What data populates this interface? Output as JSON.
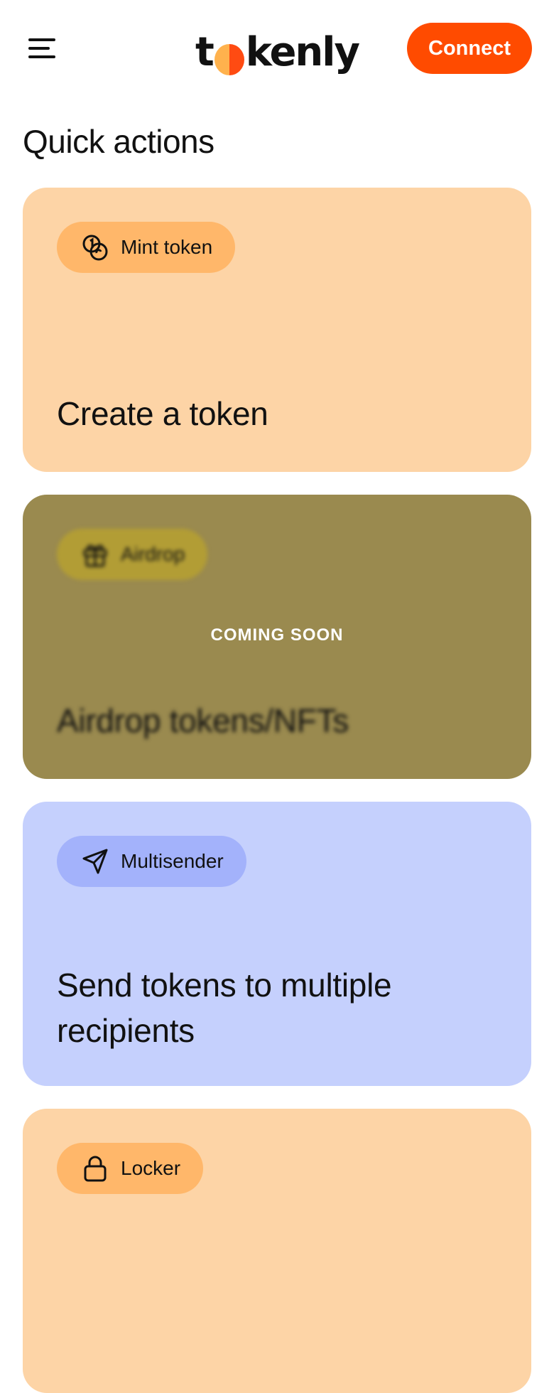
{
  "header": {
    "logo_text_left": "t",
    "logo_text_right": "kenly",
    "connect_label": "Connect",
    "brand_color": "#ff4b00"
  },
  "page": {
    "section_title": "Quick actions"
  },
  "cards": [
    {
      "pill_label": "Mint token",
      "pill_icon": "coins-icon",
      "title": "Create a token",
      "bg": "#fdd4a6"
    },
    {
      "pill_label": "Airdrop",
      "pill_icon": "gift-icon",
      "title": "Airdrop tokens/NFTs",
      "badge": "COMING SOON",
      "bg": "#9a8a4f"
    },
    {
      "pill_label": "Multisender",
      "pill_icon": "send-icon",
      "title": "Send tokens to multiple recipients",
      "bg": "#c5d0fd"
    },
    {
      "pill_label": "Locker",
      "pill_icon": "lock-icon",
      "bg": "#fdd4a6"
    }
  ]
}
